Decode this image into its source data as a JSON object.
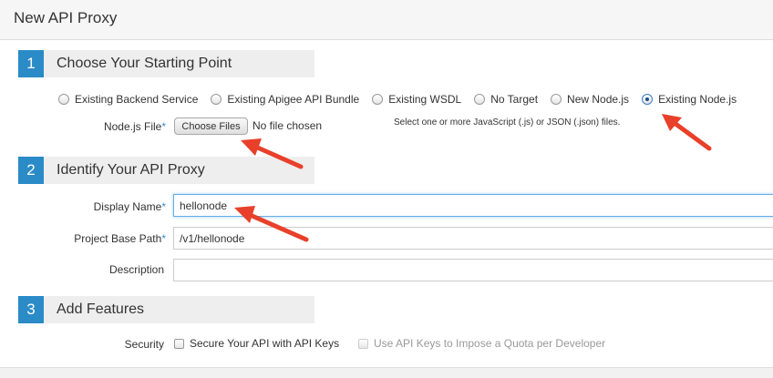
{
  "header": {
    "title": "New API Proxy"
  },
  "sections": [
    {
      "number": "1",
      "title": "Choose Your Starting Point"
    },
    {
      "number": "2",
      "title": "Identify Your API Proxy"
    },
    {
      "number": "3",
      "title": "Add Features"
    }
  ],
  "starting_point": {
    "options": [
      {
        "label": "Existing Backend Service",
        "selected": false
      },
      {
        "label": "Existing Apigee API Bundle",
        "selected": false
      },
      {
        "label": "Existing WSDL",
        "selected": false
      },
      {
        "label": "No Target",
        "selected": false
      },
      {
        "label": "New Node.js",
        "selected": false
      },
      {
        "label": "Existing Node.js",
        "selected": true
      }
    ],
    "nodejs_file_label": "Node.js File",
    "required_marker": "*",
    "choose_files_label": "Choose Files",
    "no_file_text": "No file chosen",
    "hint": "Select one or more JavaScript (.js) or JSON (.json) files."
  },
  "identify": {
    "display_name_label": "Display Name",
    "display_name_value": "hellonode",
    "base_path_label": "Project Base Path",
    "base_path_value": "/v1/hellonode",
    "description_label": "Description",
    "description_value": ""
  },
  "features": {
    "security_label": "Security",
    "api_keys_label": "Secure Your API with API Keys",
    "quota_label": "Use API Keys to Impose a Quota per Developer"
  },
  "colors": {
    "accent": "#2a8bc7",
    "annotation_arrow": "#e8402a"
  }
}
